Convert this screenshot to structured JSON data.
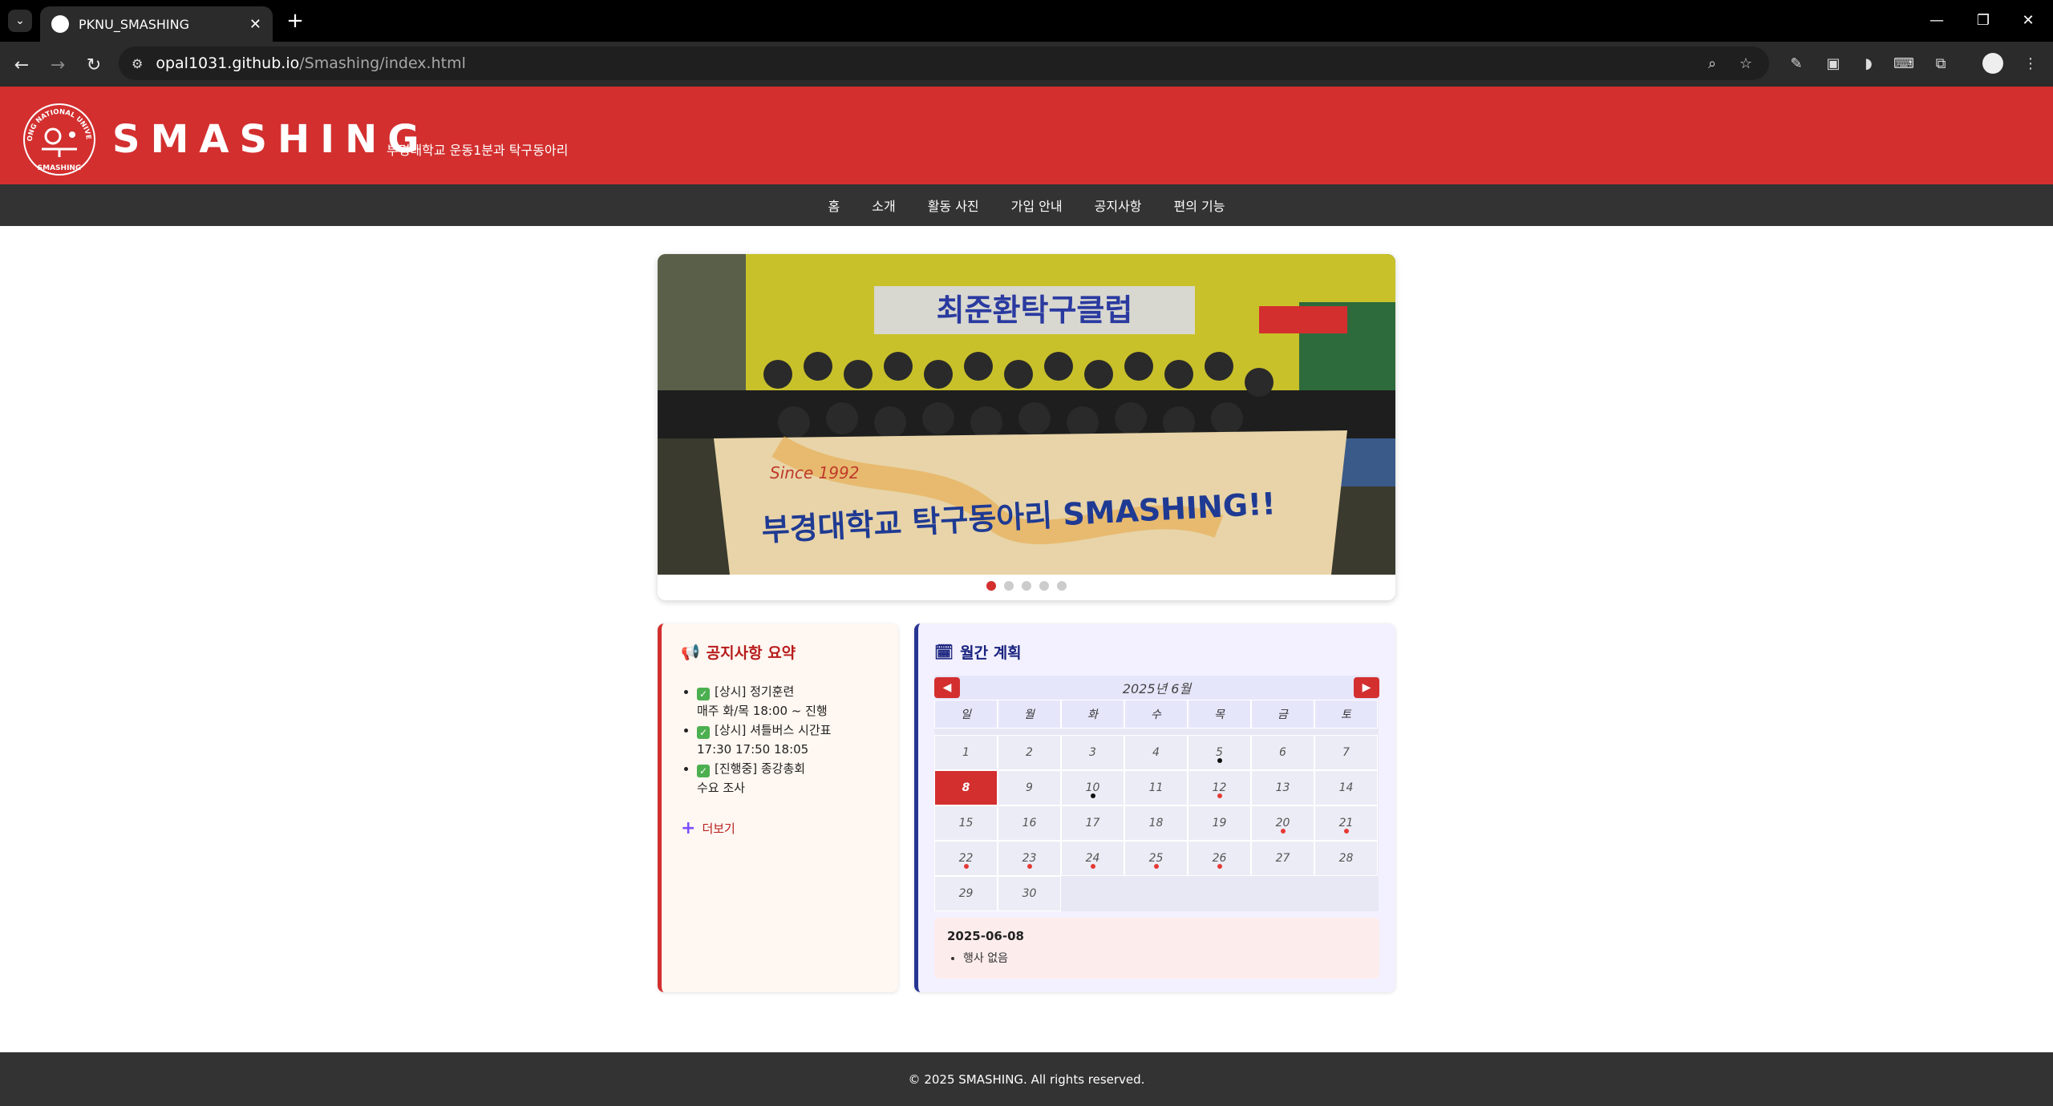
{
  "browser": {
    "tab_title": "PKNU_SMASHING",
    "url_host": "opal1031.github.io",
    "url_path": "/Smashing/index.html"
  },
  "header": {
    "brand": "SMASHING",
    "tagline": "부경대학교 운동1분과 탁구동아리",
    "logo_text_top": "PUKYONG NATIONAL UNIVERSITY",
    "logo_text_bottom": "SMASHING"
  },
  "nav": {
    "items": [
      "홈",
      "소개",
      "활동 사진",
      "가입 안내",
      "공지사항",
      "편의 기능"
    ]
  },
  "slider": {
    "banner_text": "부경대학교 탁구동아리 SMASHING!!",
    "since": "Since 1992",
    "sign": "최준환탁구클럽",
    "dot_count": 5,
    "active_index": 0
  },
  "notice": {
    "title": "공지사항 요약",
    "items": [
      {
        "label": "[상시] 정기훈련",
        "detail": "매주 화/목 18:00 ~ 진행"
      },
      {
        "label": "[상시] 셔틀버스 시간표",
        "detail": "17:30 17:50 18:05"
      },
      {
        "label": "[진행중] 종강총회",
        "detail": "수요 조사"
      }
    ],
    "more": "더보기"
  },
  "calendar": {
    "title": "월간 계획",
    "month_label": "2025년 6월",
    "weekdays": [
      "일",
      "월",
      "화",
      "수",
      "목",
      "금",
      "토"
    ],
    "start_offset": 0,
    "days_in_month": 30,
    "today": 8,
    "red_events": [
      12,
      20,
      21,
      22,
      23,
      24,
      25,
      26
    ],
    "black_events": [
      5,
      10
    ],
    "selected_date": "2025-06-08",
    "selected_events": [
      "행사 없음"
    ]
  },
  "footer": {
    "text": "© 2025 SMASHING. All rights reserved."
  },
  "colors": {
    "brand_red": "#d32f2f",
    "nav_dark": "#333333",
    "calendar_accent": "#283593"
  }
}
